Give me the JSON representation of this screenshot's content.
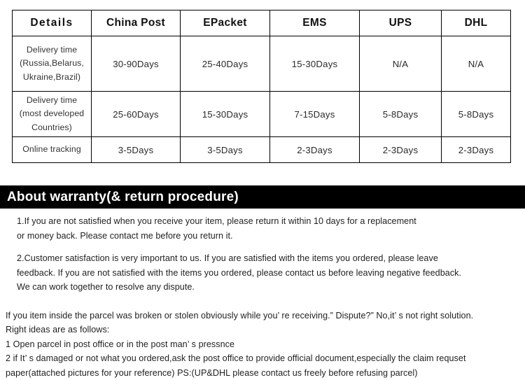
{
  "shipping_table": {
    "headers": [
      "Details",
      "China Post",
      "EPacket",
      "EMS",
      "UPS",
      "DHL"
    ],
    "rows": [
      {
        "label": "Delivery time (Russia,Belarus, Ukraine,Brazil)",
        "label_lines": [
          "Delivery time",
          "(Russia,Belarus,",
          "Ukraine,Brazil)"
        ],
        "values": [
          "30-90Days",
          "25-40Days",
          "15-30Days",
          "N/A",
          "N/A"
        ]
      },
      {
        "label": "Delivery time (most developed Countries)",
        "label_lines": [
          "Delivery time",
          "(most developed",
          "Countries)"
        ],
        "values": [
          "25-60Days",
          "15-30Days",
          "7-15Days",
          "5-8Days",
          "5-8Days"
        ]
      },
      {
        "label": "Online tracking",
        "label_lines": [
          "Online tracking"
        ],
        "values": [
          "3-5Days",
          "3-5Days",
          "2-3Days",
          "2-3Days",
          "2-3Days"
        ]
      }
    ]
  },
  "banner": {
    "title": "About warranty(& return procedure)",
    "background_color": "#000000",
    "text_color": "#ffffff"
  },
  "warranty": {
    "item1": {
      "line1": "1.If you are not satisfied when you receive your item, please return it within 10 days for a replacement",
      "line2": "or money back. Please contact me before you return it."
    },
    "item2": {
      "line1": "2.Customer satisfaction is very important to us. If you are satisfied with the items you ordered, please leave",
      "line2": "feedback. If you are not satisfied with the items you ordered, please contact us before leaving negative feedback.",
      "line3": "We can work together to resolve any dispute."
    },
    "dispute": {
      "line1": "If you item inside the parcel was broken or stolen obviously while you’ re receiving.” Dispute?” No,it’ s not right solution.",
      "line2": "Right ideas are as follows:",
      "line3": "1 Open parcel in post office or in the post man’ s pressnce",
      "line4": "2 if It’ s damaged or not what you ordered,ask the post office to provide official document,especially the claim requset",
      "line5": "paper(attached pictures for your reference)        PS:(UP&DHL please contact us freely before refusing parcel)"
    }
  }
}
